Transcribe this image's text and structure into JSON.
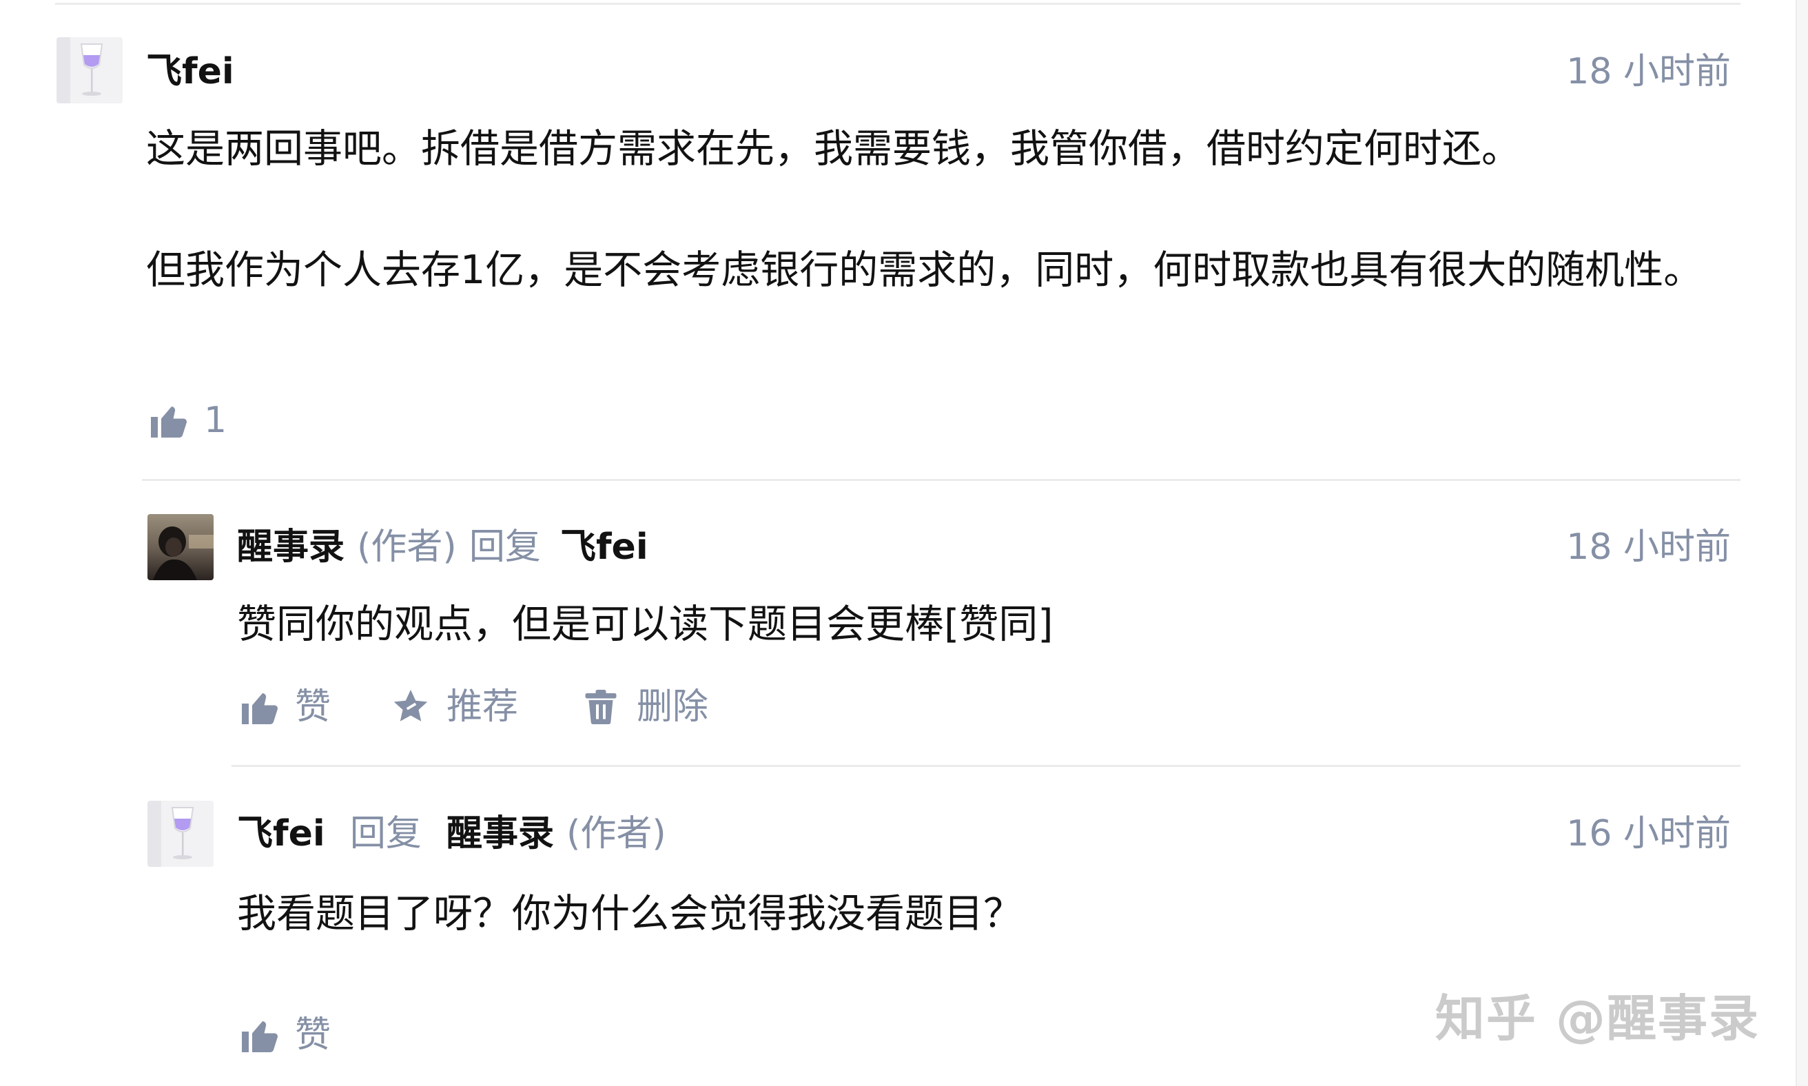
{
  "comments": [
    {
      "author": "飞fei",
      "time": "18 小时前",
      "paragraphs": [
        "这是两回事吧。拆借是借方需求在先，我需要钱，我管你借，借时约定何时还。",
        "但我作为个人去存1亿，是不会考虑银行的需求的，同时，何时取款也具有很大的随机性。"
      ],
      "like_count": "1"
    }
  ],
  "replies": [
    {
      "author": "醒事录",
      "author_tag": "(作者)",
      "reply_word": "回复",
      "reply_to": "飞fei",
      "time": "18 小时前",
      "content": "赞同你的观点，但是可以读下题目会更棒[赞同]",
      "actions": {
        "like": "赞",
        "recommend": "推荐",
        "delete": "删除"
      }
    },
    {
      "author": "飞fei",
      "reply_word": "回复",
      "reply_to": "醒事录",
      "reply_to_tag": "(作者)",
      "time": "16 小时前",
      "content": "我看题目了呀？你为什么会觉得我没看题目？",
      "actions": {
        "like": "赞"
      }
    }
  ],
  "watermark": "知乎 @醒事录",
  "colors": {
    "text": "#121212",
    "meta": "#8590a6",
    "divider": "#ebebeb",
    "avatar_glass": "#b29bf0"
  }
}
